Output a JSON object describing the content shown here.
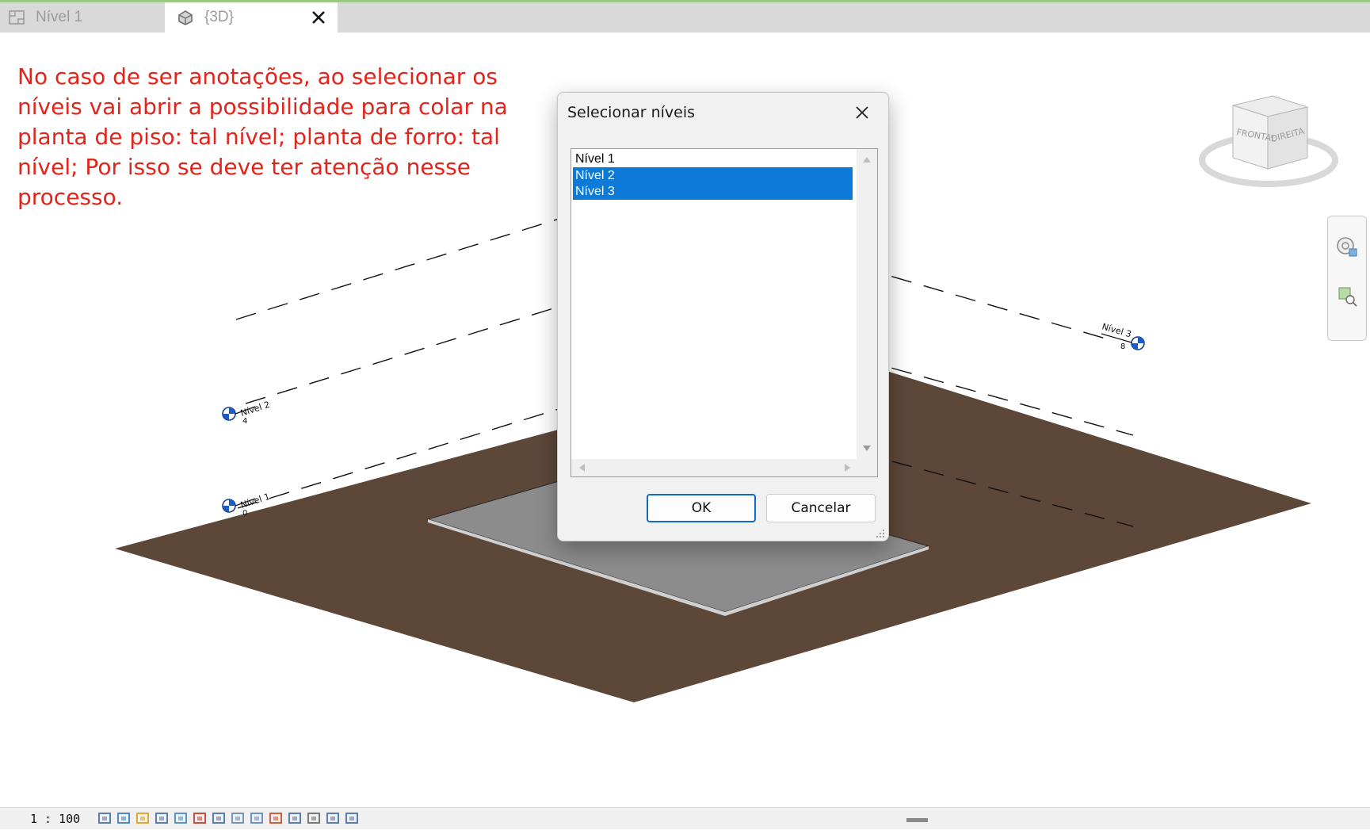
{
  "tabs": [
    {
      "label": "Nível 1",
      "icon": "floor-plan-icon",
      "active": false
    },
    {
      "label": "{3D}",
      "icon": "3d-house-icon",
      "active": true
    }
  ],
  "annotation_text": "No caso de ser anotações, ao selecionar os níveis vai abrir a possibilidade para colar na planta de piso: tal nível; planta de forro: tal nível; Por isso se deve ter atenção nesse processo.",
  "dialog": {
    "title": "Selecionar níveis",
    "items": [
      {
        "label": "Nível 1",
        "selected": false
      },
      {
        "label": "Nível 2",
        "selected": true
      },
      {
        "label": "Nível 3",
        "selected": true
      }
    ],
    "ok_label": "OK",
    "cancel_label": "Cancelar"
  },
  "viewcube": {
    "front_label": "FRONTAL",
    "right_label": "DIREITA"
  },
  "level_tags": [
    {
      "name": "Nível 1",
      "elevation": "0"
    },
    {
      "name": "Nível 2",
      "elevation": "4"
    },
    {
      "name": "Nível 3",
      "elevation": "8"
    }
  ],
  "status": {
    "scale": "1 : 100"
  },
  "view_control_icons": [
    "detail-level-icon",
    "visual-style-icon",
    "sun-path-icon",
    "shadows-icon",
    "rendering-icon",
    "crop-view-icon",
    "show-crop-icon",
    "unlock-3d-icon",
    "temporary-hide-icon",
    "reveal-hidden-icon",
    "worksharing-icon",
    "analytical-model-icon",
    "highlight-displacement-icon",
    "reveal-constraints-icon"
  ],
  "colors": {
    "floor": "#5c4739",
    "selection": "#0e7ad7",
    "annotation": "#e3241b",
    "slab": "#8c8c8c"
  }
}
